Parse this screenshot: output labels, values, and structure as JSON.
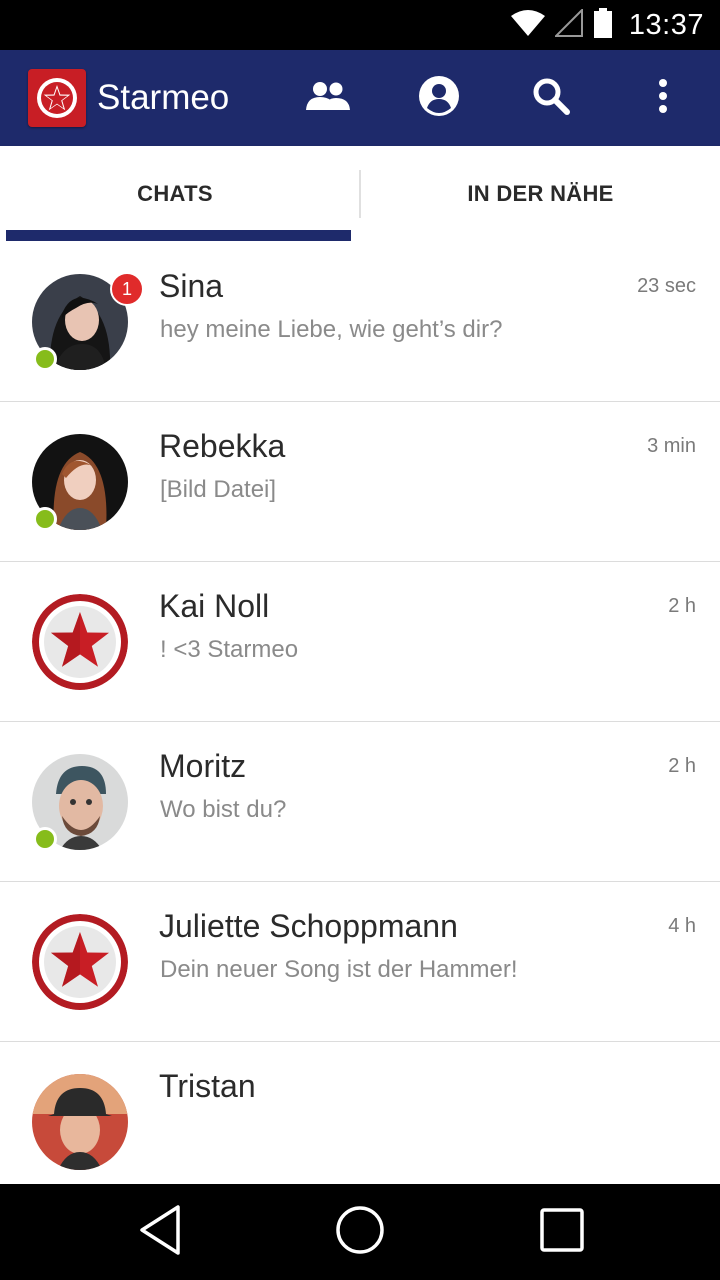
{
  "status_bar": {
    "time": "13:37",
    "icons": [
      "wifi-icon",
      "signal-icon",
      "battery-icon"
    ]
  },
  "app_bar": {
    "title": "Starmeo",
    "actions": [
      "contacts-icon",
      "profile-icon",
      "search-icon",
      "more-icon"
    ]
  },
  "tabs": [
    {
      "label": "CHATS",
      "selected": true
    },
    {
      "label": "IN DER NÄHE",
      "selected": false
    }
  ],
  "chats": [
    {
      "name": "Sina",
      "message": "hey meine Liebe, wie geht’s dir?",
      "time": "23 sec",
      "unread": "1",
      "online": true,
      "avatar": "photo"
    },
    {
      "name": "Rebekka",
      "message": "[Bild Datei]",
      "time": "3 min",
      "online": true,
      "avatar": "photo"
    },
    {
      "name": "Kai Noll",
      "message": "! <3 Starmeo",
      "time": "2 h",
      "online": false,
      "avatar": "star-logo"
    },
    {
      "name": "Moritz",
      "message": "Wo bist du?",
      "time": "2 h",
      "online": true,
      "avatar": "photo"
    },
    {
      "name": "Juliette Schoppmann",
      "message": "Dein neuer Song ist der Hammer!",
      "time": "4 h",
      "online": false,
      "avatar": "star-logo"
    },
    {
      "name": "Tristan",
      "message": "",
      "time": "",
      "online": false,
      "avatar": "photo"
    }
  ],
  "colors": {
    "app_bar": "#1e2a6b",
    "brand_red": "#c81e25",
    "online": "#86bc1b",
    "badge": "#e02b2b"
  }
}
